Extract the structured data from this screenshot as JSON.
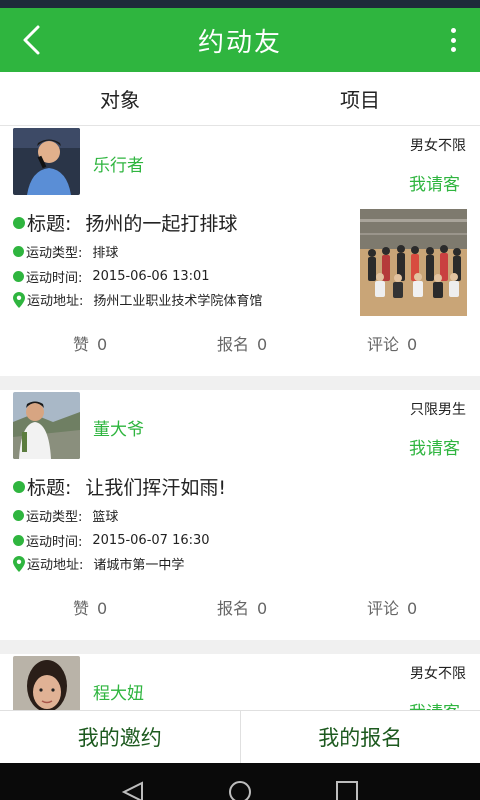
{
  "app_bar": {
    "title": "约动友",
    "back_icon": "chevron-left-icon",
    "more_icon": "more-vertical-icon"
  },
  "tabs": [
    {
      "label": "对象"
    },
    {
      "label": "项目"
    }
  ],
  "posts": [
    {
      "nickname": "乐行者",
      "gender_limit": "男女不限",
      "treat_label": "我请客",
      "title_label": "标题:",
      "title": "扬州的一起打排球",
      "type_label": "运动类型:",
      "type": "排球",
      "time_label": "运动时间:",
      "time": "2015-06-06 13:01",
      "address_label": "运动地址:",
      "address": "扬州工业职业技术学院体育馆",
      "like_label": "赞",
      "likes": "0",
      "signup_label": "报名",
      "signups": "0",
      "comment_label": "评论",
      "comments": "0"
    },
    {
      "nickname": "董大爷",
      "gender_limit": "只限男生",
      "treat_label": "我请客",
      "title_label": "标题:",
      "title": "让我们挥汗如雨!",
      "type_label": "运动类型:",
      "type": "篮球",
      "time_label": "运动时间:",
      "time": "2015-06-07 16:30",
      "address_label": "运动地址:",
      "address": "诸城市第一中学",
      "like_label": "赞",
      "likes": "0",
      "signup_label": "报名",
      "signups": "0",
      "comment_label": "评论",
      "comments": "0"
    },
    {
      "nickname": "程大妞",
      "gender_limit": "男女不限",
      "treat_label": "我请客"
    }
  ],
  "bottom_tabs": [
    {
      "label": "我的邀约"
    },
    {
      "label": "我的报名"
    }
  ],
  "colors": {
    "accent": "#2fb53f",
    "bottom_tab_text": "#1d5a1f",
    "status_bar": "#1e2a3a"
  }
}
